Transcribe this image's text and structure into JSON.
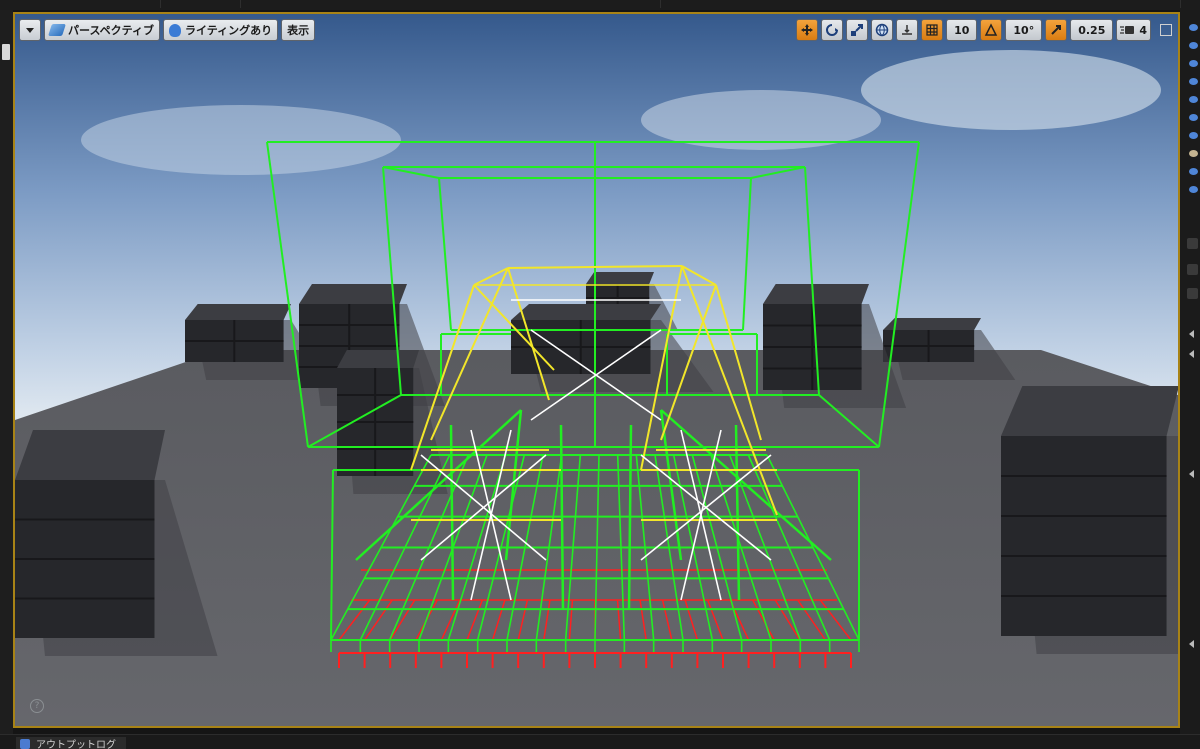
{
  "viewport": {
    "view_mode_label": "パースペクティブ",
    "lighting_label": "ライティングあり",
    "show_label": "表示",
    "grid_snap_value": "10",
    "rotation_snap_value": "10°",
    "scale_snap_value": "0.25",
    "camera_speed_value": "4"
  },
  "bottom_panel": {
    "output_log_label": "アウトプットログ"
  },
  "colors": {
    "selection_border": "#a88316",
    "bounds_green": "#22ee22",
    "spline_yellow": "#f2e62a",
    "brace_white": "#ffffff",
    "floor_red": "#ff2020"
  },
  "icons": {
    "dropdown": "chevron-down-icon",
    "perspective": "perspective-icon",
    "lighting": "lighting-icon",
    "translate": "translate-icon",
    "rotate": "rotate-icon",
    "scale": "scale-icon",
    "world": "world-icon",
    "surface_snap": "surface-snap-icon",
    "grid": "grid-icon",
    "angle": "angle-icon",
    "scale_snap": "scale-snap-icon",
    "camera_speed": "camera-speed-icon",
    "maximize": "maximize-icon",
    "help": "help-icon"
  }
}
